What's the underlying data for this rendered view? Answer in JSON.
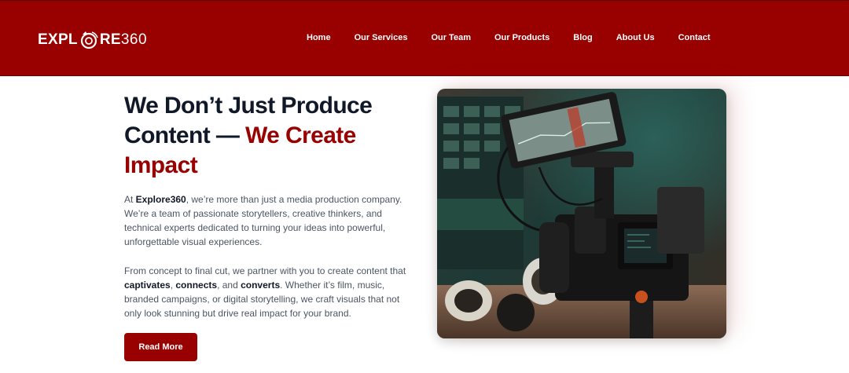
{
  "brand": {
    "logo_prefix": "EXPL",
    "logo_suffix": "RE",
    "logo_number": "360",
    "accent_color": "#990000"
  },
  "nav": {
    "items": [
      "Home",
      "Our Services",
      "Our Team",
      "Our Products",
      "Blog",
      "About Us",
      "Contact"
    ]
  },
  "hero": {
    "title_line1": "We Don’t Just Produce",
    "title_line2_start": "Content — ",
    "title_line2_accent": "We Create",
    "title_line3": "Impact",
    "p1": {
      "t1": "At ",
      "b1": "Explore360",
      "t2": ", we’re more than just a media production company. We’re a team of passionate storytellers, creative thinkers, and technical experts dedicated to turning your ideas into powerful, unforgettable visual experiences."
    },
    "p2": {
      "t1": "From concept to final cut, we partner with you to create content that ",
      "b1": "captivates",
      "t2": ", ",
      "b2": "connects",
      "t3": ", and ",
      "b3": "converts",
      "t4": ". Whether it’s film, music, branded campaigns, or digital storytelling, we craft visuals that not only look stunning but drive real impact for your brand."
    },
    "cta_label": "Read More",
    "image_icon": "camera-rig-photo-icon"
  }
}
